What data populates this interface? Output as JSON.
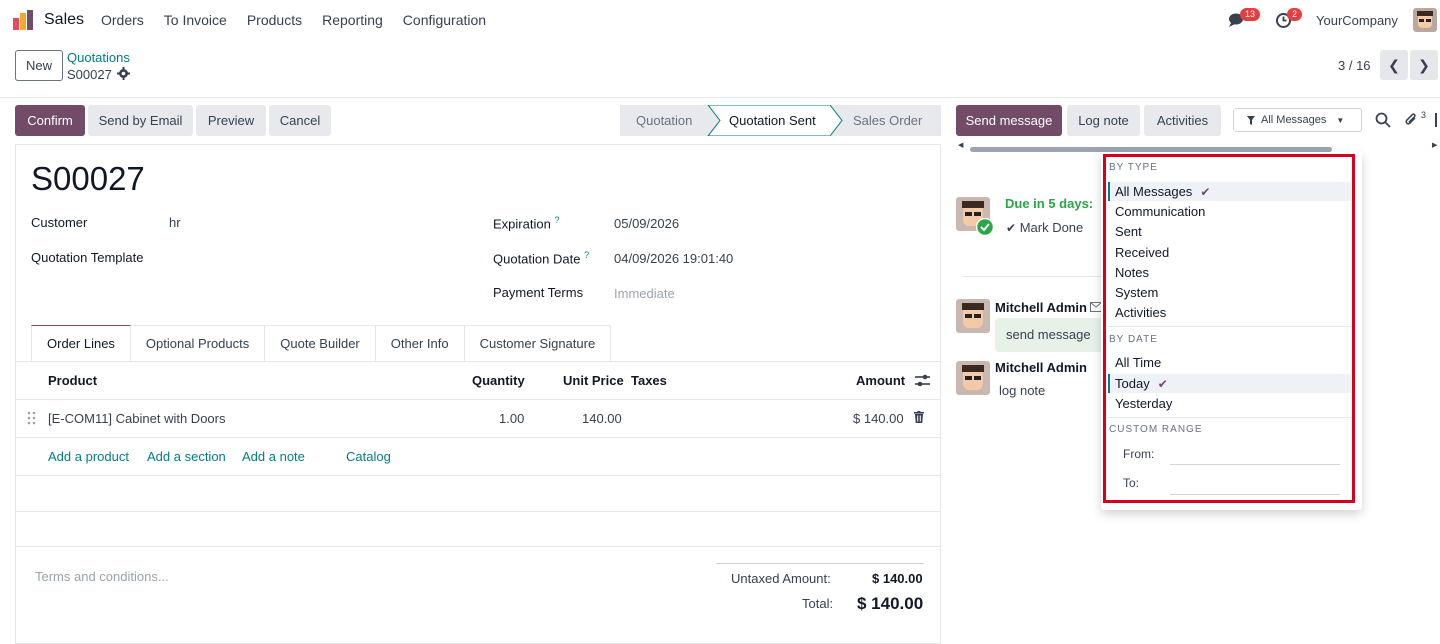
{
  "navbar": {
    "app_name": "Sales",
    "menu": [
      "Orders",
      "To Invoice",
      "Products",
      "Reporting",
      "Configuration"
    ],
    "chat_count": "13",
    "activity_count": "2",
    "company": "YourCompany"
  },
  "control": {
    "new_label": "New",
    "breadcrumb_parent": "Quotations",
    "breadcrumb_current": "S00027",
    "pager": "3 / 16"
  },
  "status_buttons": {
    "confirm": "Confirm",
    "send_email": "Send by Email",
    "preview": "Preview",
    "cancel": "Cancel"
  },
  "stages": [
    "Quotation",
    "Quotation Sent",
    "Sales Order"
  ],
  "active_stage": "Quotation Sent",
  "form": {
    "name": "S00027",
    "customer_label": "Customer",
    "customer_value": "hr",
    "template_label": "Quotation Template",
    "expiration_label": "Expiration",
    "expiration_value": "05/09/2026",
    "quotation_date_label": "Quotation Date",
    "quotation_date_value": "04/09/2026 19:01:40",
    "payment_terms_label": "Payment Terms",
    "payment_terms_value": "Immediate",
    "help_mark": "?"
  },
  "tabs": [
    "Order Lines",
    "Optional Products",
    "Quote Builder",
    "Other Info",
    "Customer Signature"
  ],
  "order_table": {
    "headers": {
      "product": "Product",
      "quantity": "Quantity",
      "unit_price": "Unit Price",
      "taxes": "Taxes",
      "amount": "Amount"
    },
    "rows": [
      {
        "product": "[E-COM11] Cabinet with Doors",
        "quantity": "1.00",
        "unit_price": "140.00",
        "taxes": "",
        "amount": "$ 140.00"
      }
    ],
    "add_links": [
      "Add a product",
      "Add a section",
      "Add a note",
      "Catalog"
    ]
  },
  "footer": {
    "terms_placeholder": "Terms and conditions...",
    "untaxed_label": "Untaxed Amount:",
    "untaxed_value": "$ 140.00",
    "total_label": "Total:",
    "total_value": "$ 140.00"
  },
  "chatter": {
    "send_message": "Send message",
    "log_note": "Log note",
    "activities": "Activities",
    "filter_label": "All Messages",
    "attachment_count": "3",
    "activity_due": "Due in 5 days:",
    "mark_done": "Mark Done",
    "messages": [
      {
        "author": "Mitchell Admin",
        "body": "send message"
      },
      {
        "author": "Mitchell Admin",
        "body": "log note"
      }
    ]
  },
  "dropdown": {
    "by_type_header": "BY TYPE",
    "by_type": [
      "All Messages",
      "Communication",
      "Sent",
      "Received",
      "Notes",
      "System",
      "Activities"
    ],
    "by_type_selected": "All Messages",
    "by_date_header": "BY DATE",
    "by_date": [
      "All Time",
      "Today",
      "Yesterday"
    ],
    "by_date_selected": "Today",
    "custom_range_header": "CUSTOM RANGE",
    "from_label": "From:",
    "to_label": "To:"
  },
  "colors": {
    "brand": "#714b67",
    "link": "#017e84",
    "success": "#28a745",
    "highlight": "#d6001c"
  }
}
